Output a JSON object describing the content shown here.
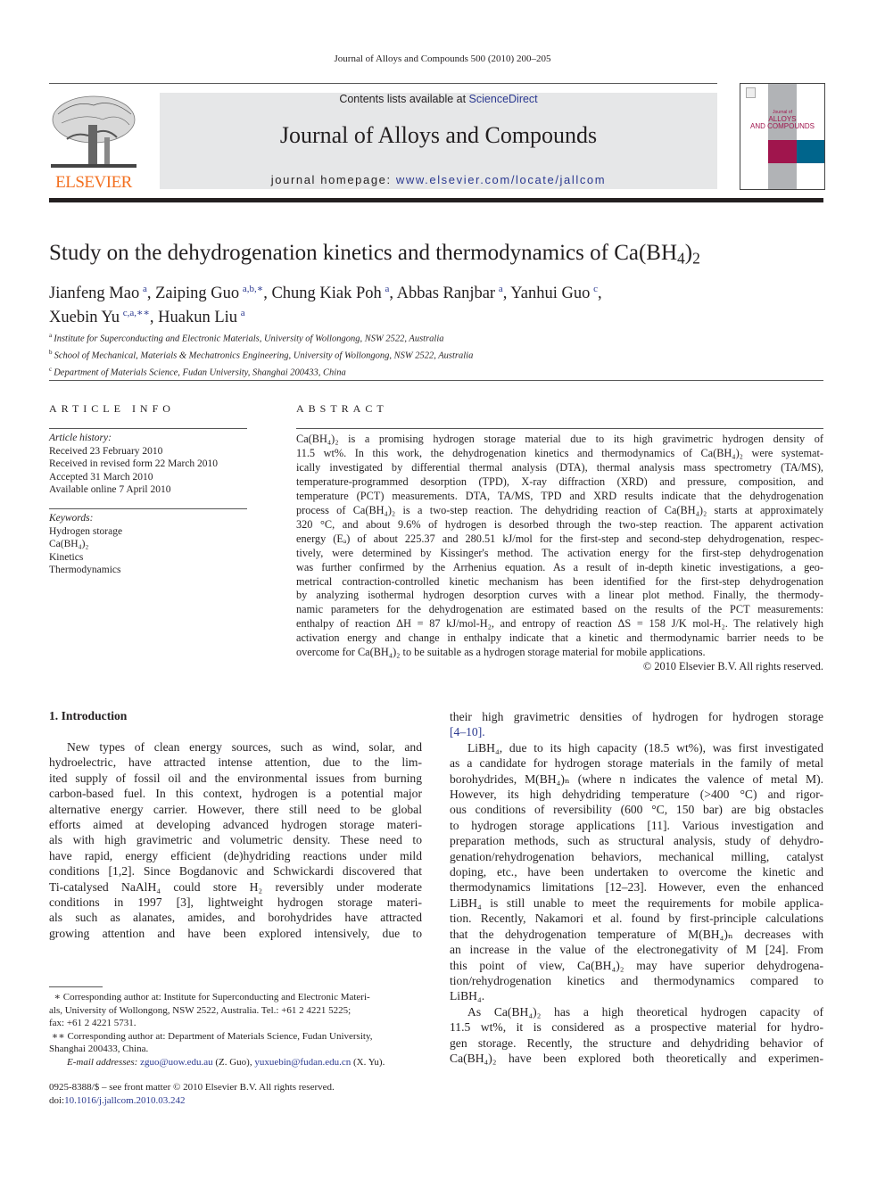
{
  "running_head": "Journal of Alloys and Compounds 500 (2010) 200–205",
  "masthead": {
    "publisher_logo_text": "ELSEVIER",
    "contents_prefix": "Contents lists available at ",
    "contents_link": "ScienceDirect",
    "journal_title": "Journal of Alloys and Compounds",
    "homepage_prefix": "journal homepage: ",
    "homepage_link": "www.elsevier.com/locate/jallcom",
    "cover_line1": "Journal of",
    "cover_line2": "ALLOYS",
    "cover_line3": "AND COMPOUNDS",
    "cover_colors": {
      "gray": "#b1b3b6",
      "magenta": "#a0154d",
      "teal": "#00658c"
    },
    "elsevier_orange": "#f37021"
  },
  "article": {
    "title_main": "Study on the dehydrogenation kinetics and thermodynamics of Ca(BH",
    "title_sub4": "4",
    "title_close": ")",
    "title_sub2": "2",
    "authors": [
      {
        "name": "Jianfeng Mao",
        "aff": "a"
      },
      {
        "name": "Zaiping Guo",
        "aff": "a,b,∗"
      },
      {
        "name": "Chung Kiak Poh",
        "aff": "a"
      },
      {
        "name": "Abbas Ranjbar",
        "aff": "a"
      },
      {
        "name": "Yanhui Guo",
        "aff": "c"
      },
      {
        "name": "Xuebin Yu",
        "aff": "c,a,∗∗"
      },
      {
        "name": "Huakun Liu",
        "aff": "a"
      }
    ],
    "affiliations": [
      {
        "mark": "a",
        "text": "Institute for Superconducting and Electronic Materials, University of Wollongong, NSW 2522, Australia"
      },
      {
        "mark": "b",
        "text": "School of Mechanical, Materials & Mechatronics Engineering, University of Wollongong, NSW 2522, Australia"
      },
      {
        "mark": "c",
        "text": "Department of Materials Science, Fudan University, Shanghai 200433, China"
      }
    ]
  },
  "article_info": {
    "heading": "ARTICLE INFO",
    "history_label": "Article history:",
    "history": [
      "Received 23 February 2010",
      "Received in revised form 22 March 2010",
      "Accepted 31 March 2010",
      "Available online 7 April 2010"
    ],
    "keywords_label": "Keywords:",
    "keywords": [
      "Hydrogen storage",
      "Ca(BH₄)₂",
      "Kinetics",
      "Thermodynamics"
    ]
  },
  "abstract": {
    "heading": "ABSTRACT",
    "lines": [
      "Ca(BH₄)₂ is a promising hydrogen storage material due to its high gravimetric hydrogen density of",
      "11.5 wt%. In this work, the dehydrogenation kinetics and thermodynamics of Ca(BH₄)₂ were systemat-",
      "ically investigated by differential thermal analysis (DTA), thermal analysis mass spectrometry (TA/MS),",
      "temperature-programmed desorption (TPD), X-ray diffraction (XRD) and pressure, composition, and",
      "temperature (PCT) measurements. DTA, TA/MS, TPD and XRD results indicate that the dehydrogenation",
      "process of Ca(BH₄)₂ is a two-step reaction. The dehydriding reaction of Ca(BH₄)₂ starts at approximately",
      "320 °C, and about 9.6% of hydrogen is desorbed through the two-step reaction. The apparent activation",
      "energy (Eₐ) of about 225.37 and 280.51 kJ/mol for the first-step and second-step dehydrogenation, respec-",
      "tively, were determined by Kissinger's method. The activation energy for the first-step dehydrogenation",
      "was further confirmed by the Arrhenius equation. As a result of in-depth kinetic investigations, a geo-",
      "metrical contraction-controlled kinetic mechanism has been identified for the first-step dehydrogenation",
      "by analyzing isothermal hydrogen desorption curves with a linear plot method. Finally, the thermody-",
      "namic parameters for the dehydrogenation are estimated based on the results of the PCT measurements:",
      "enthalpy of reaction ΔH = 87 kJ/mol-H₂, and entropy of reaction ΔS = 158 J/K mol-H₂. The relatively high",
      "activation energy and change in enthalpy indicate that a kinetic and thermodynamic barrier needs to be",
      "overcome for Ca(BH₄)₂ to be suitable as a hydrogen storage material for mobile applications."
    ],
    "copyright": "© 2010 Elsevier B.V. All rights reserved."
  },
  "intro": {
    "section_title": "1.  Introduction",
    "left_lines": [
      "New types of clean energy sources, such as wind, solar, and",
      "hydroelectric, have attracted intense attention, due to the lim-",
      "ited supply of fossil oil and the environmental issues from burning",
      "carbon-based fuel. In this context, hydrogen is a potential major",
      "alternative energy carrier. However, there still need to be global",
      "efforts aimed at developing advanced hydrogen storage materi-",
      "als with high gravimetric and volumetric density. These need to",
      "have rapid, energy efficient (de)hydriding reactions under mild",
      "conditions [1,2]. Since Bogdanovic and Schwickardi discovered that",
      "Ti-catalysed NaAlH₄ could store H₂ reversibly under moderate",
      "conditions in 1997 [3], lightweight hydrogen storage materi-",
      "als such as alanates, amides, and borohydrides have attracted",
      "growing attention and have been explored intensively, due to"
    ],
    "right_lines": [
      "their high gravimetric densities of hydrogen for hydrogen storage",
      "[4–10].",
      "LiBH₄, due to its high capacity (18.5 wt%), was first investigated",
      "as a candidate for hydrogen storage materials in the family of metal",
      "borohydrides, M(BH₄)ₙ (where n indicates the valence of metal M).",
      "However, its high dehydriding temperature (>400 °C) and rigor-",
      "ous conditions of reversibility (600 °C, 150 bar) are big obstacles",
      "to hydrogen storage applications [11]. Various investigation and",
      "preparation methods, such as structural analysis, study of dehydro-",
      "genation/rehydrogenation behaviors, mechanical milling, catalyst",
      "doping, etc., have been undertaken to overcome the kinetic and",
      "thermodynamics limitations [12–23]. However, even the enhanced",
      "LiBH₄ is still unable to meet the requirements for mobile applica-",
      "tion. Recently, Nakamori et al. found by first-principle calculations",
      "that the dehydrogenation temperature of M(BH₄)ₙ decreases with",
      "an increase in the value of the electronegativity of M [24]. From",
      "this point of view, Ca(BH₄)₂ may have superior dehydrogena-",
      "tion/rehydrogenation kinetics and thermodynamics compared to",
      "LiBH₄.",
      "As Ca(BH₄)₂ has a high theoretical hydrogen capacity of",
      "11.5 wt%, it is considered as a prospective material for hydro-",
      "gen storage. Recently, the structure and dehydriding behavior of",
      "Ca(BH₄)₂ have been explored both theoretically and experimen-"
    ]
  },
  "footnotes": {
    "lines": [
      "  ∗ Corresponding author at: Institute for Superconducting and Electronic Materi-",
      "als, University of Wollongong, NSW 2522, Australia. Tel.: +61 2 4221 5225;",
      "fax: +61 2 4221 5731.",
      " ∗∗ Corresponding author at: Department of Materials Science, Fudan University,",
      "Shanghai 200433, China."
    ],
    "email_label": "E-mail addresses:",
    "email1": "zguo@uow.edu.au",
    "email1_who": " (Z. Guo), ",
    "email2": "yuxuebin@fudan.edu.cn",
    "email2_who": " (X. Yu)."
  },
  "footer": {
    "issn_line": "0925-8388/$ – see front matter © 2010 Elsevier B.V. All rights reserved.",
    "doi_prefix": "doi:",
    "doi_link": "10.1016/j.jallcom.2010.03.242"
  },
  "colors": {
    "link": "#2b3990",
    "text": "#231f20",
    "banner_bg": "#e6e7e8"
  }
}
